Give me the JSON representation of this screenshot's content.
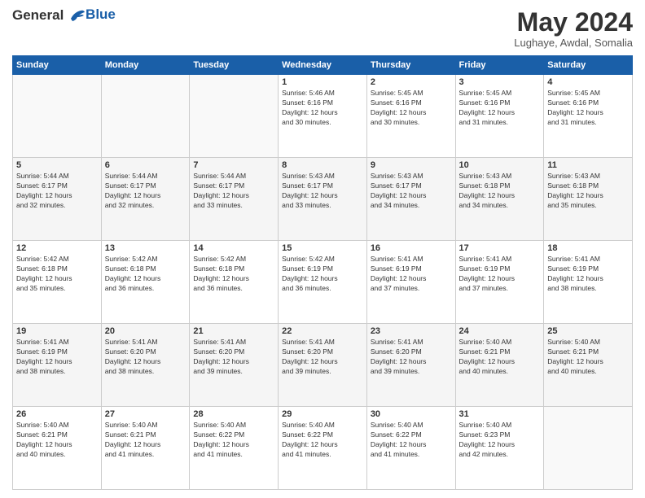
{
  "logo": {
    "line1": "General",
    "line2": "Blue"
  },
  "title": "May 2024",
  "location": "Lughaye, Awdal, Somalia",
  "weekdays": [
    "Sunday",
    "Monday",
    "Tuesday",
    "Wednesday",
    "Thursday",
    "Friday",
    "Saturday"
  ],
  "weeks": [
    [
      {
        "day": "",
        "info": ""
      },
      {
        "day": "",
        "info": ""
      },
      {
        "day": "",
        "info": ""
      },
      {
        "day": "1",
        "info": "Sunrise: 5:46 AM\nSunset: 6:16 PM\nDaylight: 12 hours\nand 30 minutes."
      },
      {
        "day": "2",
        "info": "Sunrise: 5:45 AM\nSunset: 6:16 PM\nDaylight: 12 hours\nand 30 minutes."
      },
      {
        "day": "3",
        "info": "Sunrise: 5:45 AM\nSunset: 6:16 PM\nDaylight: 12 hours\nand 31 minutes."
      },
      {
        "day": "4",
        "info": "Sunrise: 5:45 AM\nSunset: 6:16 PM\nDaylight: 12 hours\nand 31 minutes."
      }
    ],
    [
      {
        "day": "5",
        "info": "Sunrise: 5:44 AM\nSunset: 6:17 PM\nDaylight: 12 hours\nand 32 minutes."
      },
      {
        "day": "6",
        "info": "Sunrise: 5:44 AM\nSunset: 6:17 PM\nDaylight: 12 hours\nand 32 minutes."
      },
      {
        "day": "7",
        "info": "Sunrise: 5:44 AM\nSunset: 6:17 PM\nDaylight: 12 hours\nand 33 minutes."
      },
      {
        "day": "8",
        "info": "Sunrise: 5:43 AM\nSunset: 6:17 PM\nDaylight: 12 hours\nand 33 minutes."
      },
      {
        "day": "9",
        "info": "Sunrise: 5:43 AM\nSunset: 6:17 PM\nDaylight: 12 hours\nand 34 minutes."
      },
      {
        "day": "10",
        "info": "Sunrise: 5:43 AM\nSunset: 6:18 PM\nDaylight: 12 hours\nand 34 minutes."
      },
      {
        "day": "11",
        "info": "Sunrise: 5:43 AM\nSunset: 6:18 PM\nDaylight: 12 hours\nand 35 minutes."
      }
    ],
    [
      {
        "day": "12",
        "info": "Sunrise: 5:42 AM\nSunset: 6:18 PM\nDaylight: 12 hours\nand 35 minutes."
      },
      {
        "day": "13",
        "info": "Sunrise: 5:42 AM\nSunset: 6:18 PM\nDaylight: 12 hours\nand 36 minutes."
      },
      {
        "day": "14",
        "info": "Sunrise: 5:42 AM\nSunset: 6:18 PM\nDaylight: 12 hours\nand 36 minutes."
      },
      {
        "day": "15",
        "info": "Sunrise: 5:42 AM\nSunset: 6:19 PM\nDaylight: 12 hours\nand 36 minutes."
      },
      {
        "day": "16",
        "info": "Sunrise: 5:41 AM\nSunset: 6:19 PM\nDaylight: 12 hours\nand 37 minutes."
      },
      {
        "day": "17",
        "info": "Sunrise: 5:41 AM\nSunset: 6:19 PM\nDaylight: 12 hours\nand 37 minutes."
      },
      {
        "day": "18",
        "info": "Sunrise: 5:41 AM\nSunset: 6:19 PM\nDaylight: 12 hours\nand 38 minutes."
      }
    ],
    [
      {
        "day": "19",
        "info": "Sunrise: 5:41 AM\nSunset: 6:19 PM\nDaylight: 12 hours\nand 38 minutes."
      },
      {
        "day": "20",
        "info": "Sunrise: 5:41 AM\nSunset: 6:20 PM\nDaylight: 12 hours\nand 38 minutes."
      },
      {
        "day": "21",
        "info": "Sunrise: 5:41 AM\nSunset: 6:20 PM\nDaylight: 12 hours\nand 39 minutes."
      },
      {
        "day": "22",
        "info": "Sunrise: 5:41 AM\nSunset: 6:20 PM\nDaylight: 12 hours\nand 39 minutes."
      },
      {
        "day": "23",
        "info": "Sunrise: 5:41 AM\nSunset: 6:20 PM\nDaylight: 12 hours\nand 39 minutes."
      },
      {
        "day": "24",
        "info": "Sunrise: 5:40 AM\nSunset: 6:21 PM\nDaylight: 12 hours\nand 40 minutes."
      },
      {
        "day": "25",
        "info": "Sunrise: 5:40 AM\nSunset: 6:21 PM\nDaylight: 12 hours\nand 40 minutes."
      }
    ],
    [
      {
        "day": "26",
        "info": "Sunrise: 5:40 AM\nSunset: 6:21 PM\nDaylight: 12 hours\nand 40 minutes."
      },
      {
        "day": "27",
        "info": "Sunrise: 5:40 AM\nSunset: 6:21 PM\nDaylight: 12 hours\nand 41 minutes."
      },
      {
        "day": "28",
        "info": "Sunrise: 5:40 AM\nSunset: 6:22 PM\nDaylight: 12 hours\nand 41 minutes."
      },
      {
        "day": "29",
        "info": "Sunrise: 5:40 AM\nSunset: 6:22 PM\nDaylight: 12 hours\nand 41 minutes."
      },
      {
        "day": "30",
        "info": "Sunrise: 5:40 AM\nSunset: 6:22 PM\nDaylight: 12 hours\nand 41 minutes."
      },
      {
        "day": "31",
        "info": "Sunrise: 5:40 AM\nSunset: 6:23 PM\nDaylight: 12 hours\nand 42 minutes."
      },
      {
        "day": "",
        "info": ""
      }
    ]
  ]
}
